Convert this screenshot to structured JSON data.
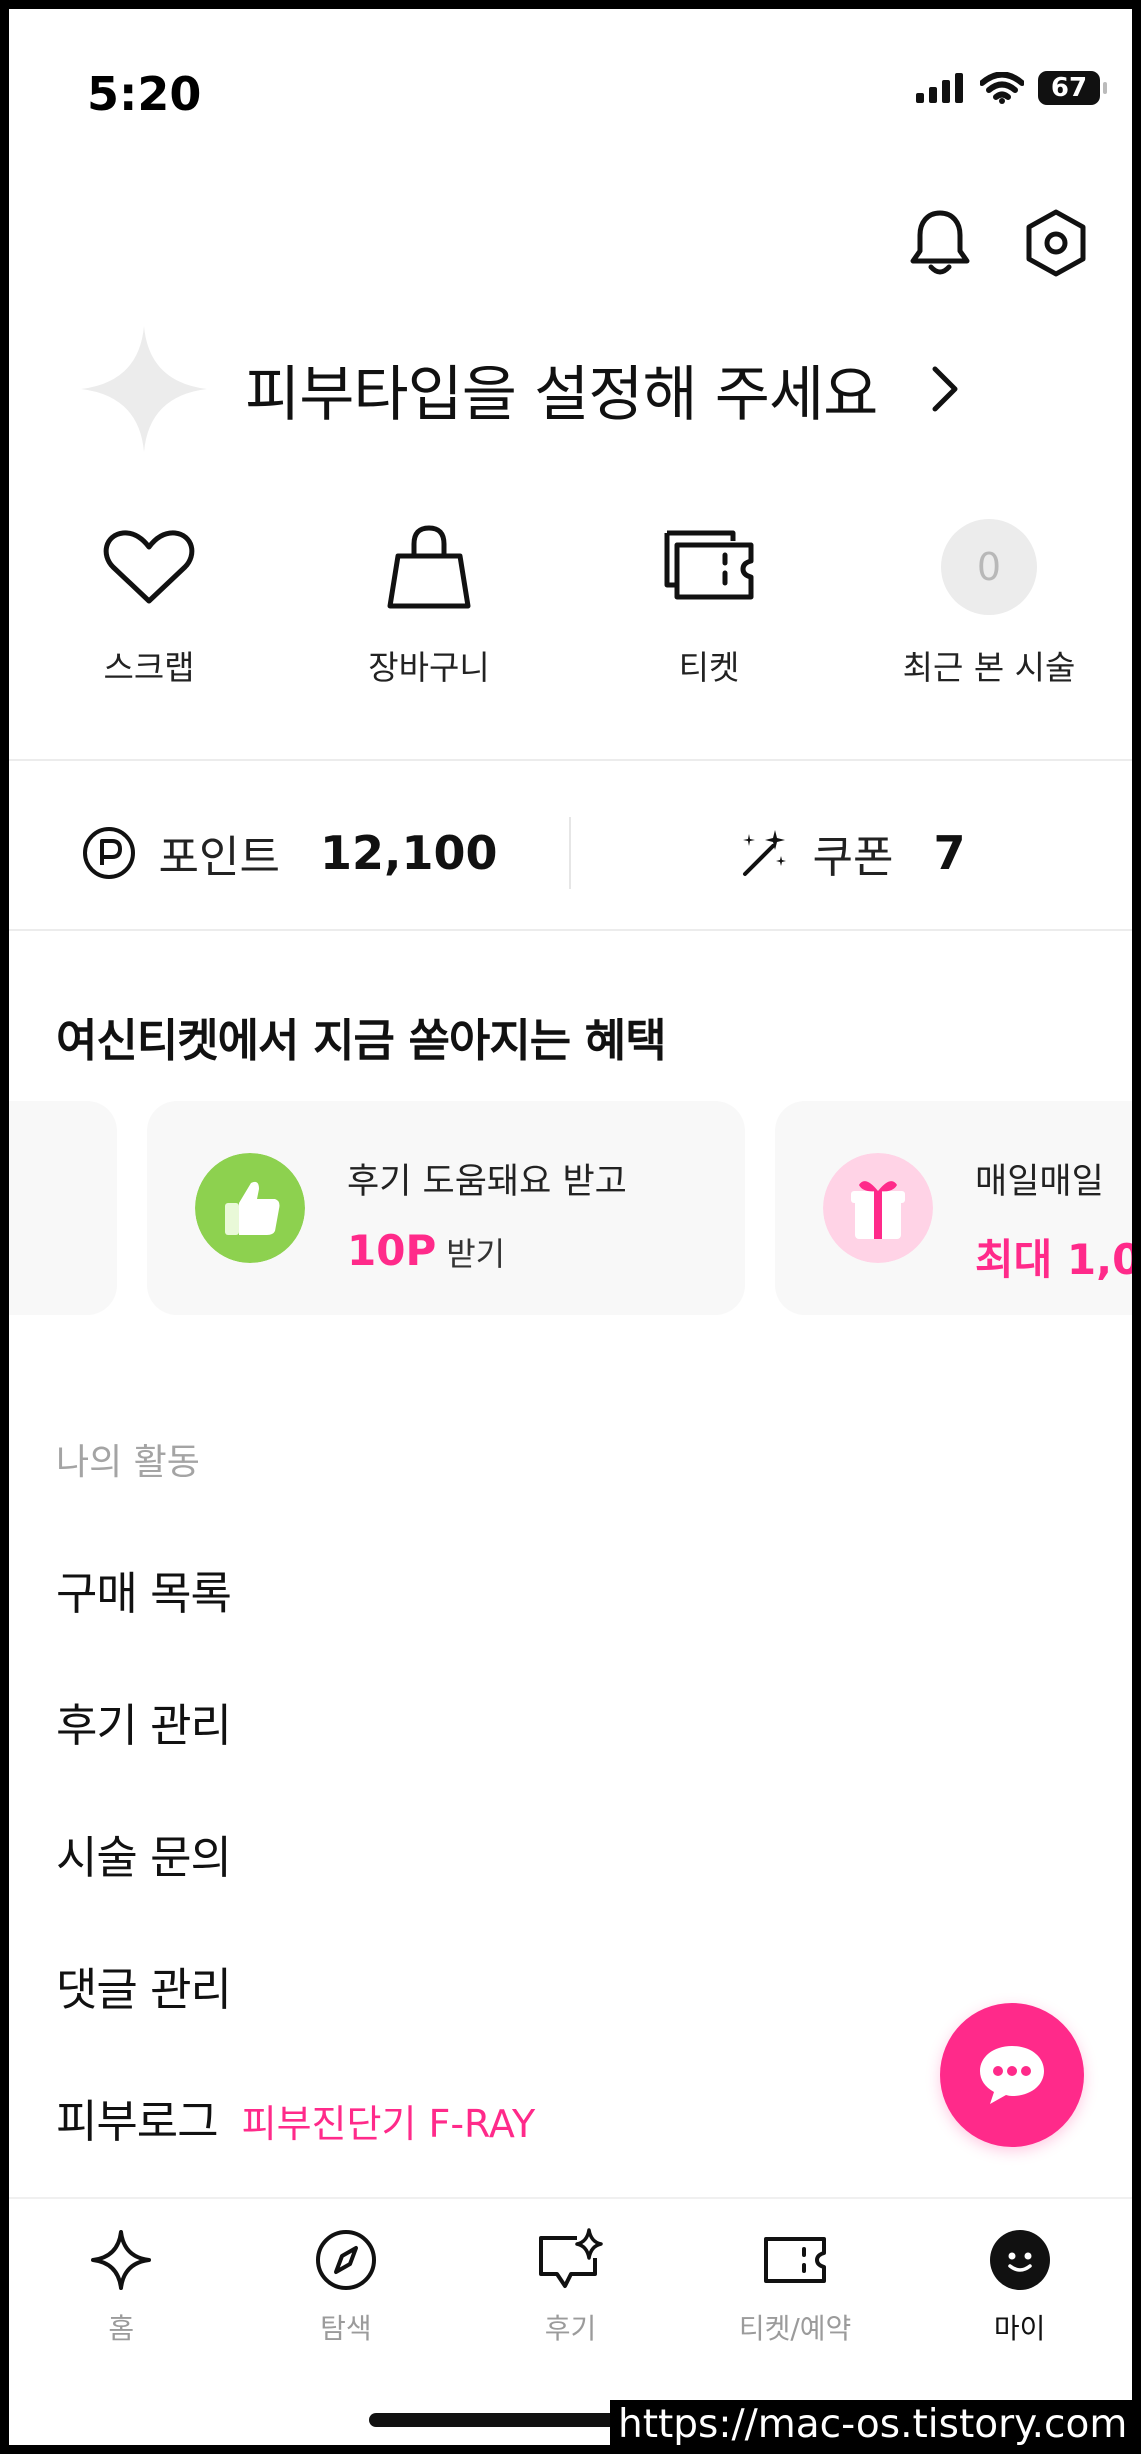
{
  "status_bar": {
    "time": "5:20",
    "battery": "67"
  },
  "profile": {
    "prompt": "피부타입을 설정해 주세요"
  },
  "quick_menu": [
    {
      "label": "스크랩",
      "icon": "heart-icon"
    },
    {
      "label": "장바구니",
      "icon": "shopping-bag-icon"
    },
    {
      "label": "티켓",
      "icon": "ticket-icon"
    },
    {
      "label": "최근 본 시술",
      "icon": "recent-count-badge",
      "count": "0"
    }
  ],
  "points": {
    "label": "포인트",
    "value": "12,100"
  },
  "coupon": {
    "label": "쿠폰",
    "value": "7"
  },
  "benefits": {
    "title": "여신티켓에서 지금 쏟아지는 혜택",
    "cards": [
      {
        "line1": "후기 도움돼요 받고",
        "highlight": "10P",
        "suffix": "받기",
        "icon": "thumbs-up-icon",
        "icon_color": "#8dd14f"
      },
      {
        "line1": "매일매일",
        "highlight": "최대 1,0",
        "icon": "gift-icon",
        "icon_color": "#ffd3e6"
      }
    ]
  },
  "activity": {
    "section_label": "나의 활동",
    "items": [
      {
        "label": "구매 목록"
      },
      {
        "label": "후기 관리"
      },
      {
        "label": "시술 문의"
      },
      {
        "label": "댓글 관리"
      },
      {
        "label": "피부로그",
        "tag": "피부진단기 F-RAY"
      }
    ]
  },
  "tabbar": {
    "tabs": [
      {
        "label": "홈",
        "icon": "sparkle-icon"
      },
      {
        "label": "탐색",
        "icon": "compass-icon"
      },
      {
        "label": "후기",
        "icon": "review-icon"
      },
      {
        "label": "티켓/예약",
        "icon": "ticket-icon"
      },
      {
        "label": "마이",
        "icon": "profile-smile-icon",
        "active": true
      }
    ]
  },
  "watermark": "https://mac-os.tistory.com",
  "colors": {
    "accent": "#ff2a8a",
    "green": "#8dd14f",
    "muted": "#a4a4a4"
  }
}
